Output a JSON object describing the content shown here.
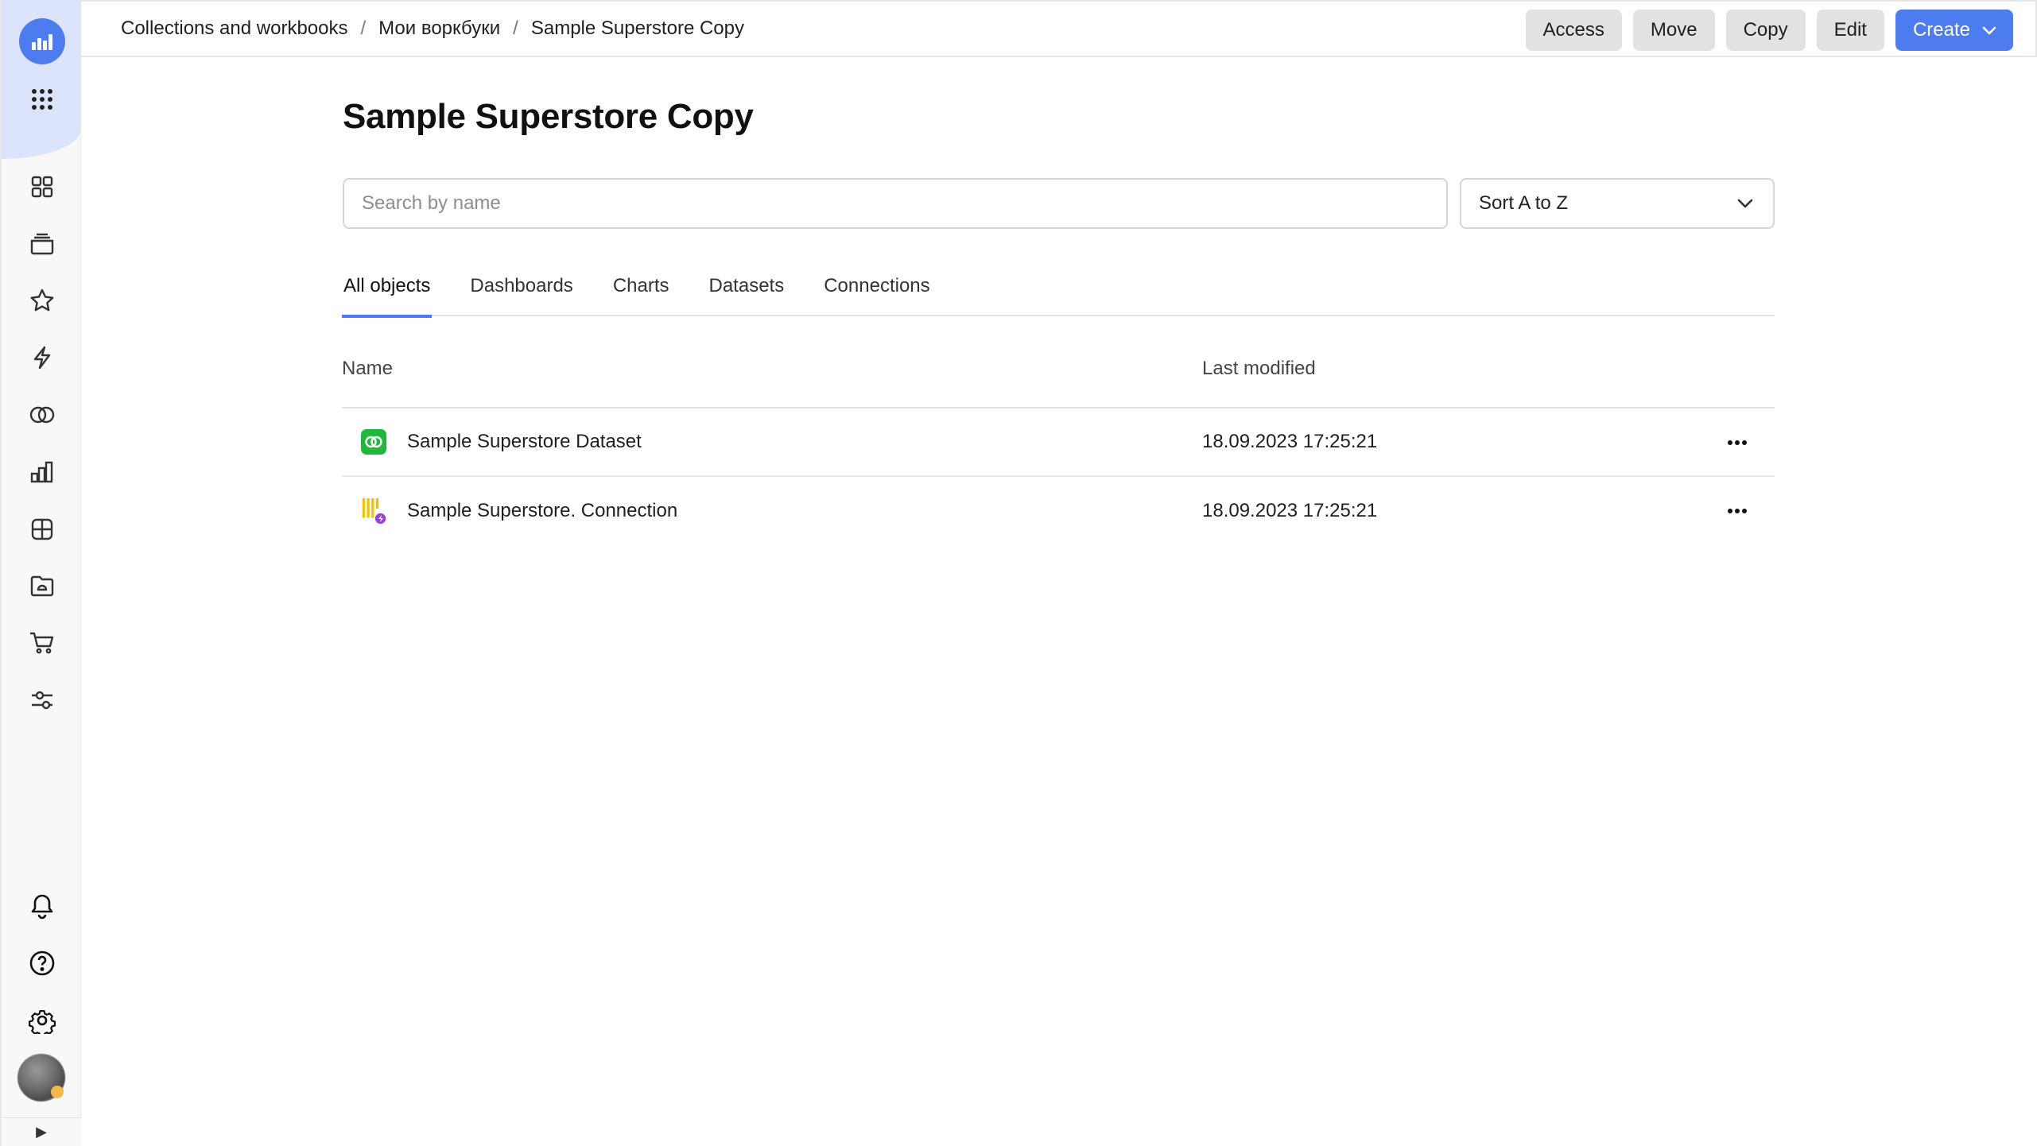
{
  "breadcrumb": {
    "items": [
      "Collections and workbooks",
      "Мои воркбуки",
      "Sample Superstore Copy"
    ],
    "separator": "/"
  },
  "actions": {
    "access": "Access",
    "move": "Move",
    "copy": "Copy",
    "edit": "Edit",
    "create": "Create"
  },
  "page": {
    "title": "Sample Superstore Copy"
  },
  "search": {
    "placeholder": "Search by name",
    "value": ""
  },
  "sort": {
    "selected": "Sort A to Z"
  },
  "tabs": [
    {
      "label": "All objects",
      "active": true
    },
    {
      "label": "Dashboards",
      "active": false
    },
    {
      "label": "Charts",
      "active": false
    },
    {
      "label": "Datasets",
      "active": false
    },
    {
      "label": "Connections",
      "active": false
    }
  ],
  "table": {
    "columns": {
      "name": "Name",
      "modified": "Last modified"
    },
    "rows": [
      {
        "name": "Sample Superstore Dataset",
        "modified": "18.09.2023 17:25:21",
        "icon": "dataset-icon"
      },
      {
        "name": "Sample Superstore. Connection",
        "modified": "18.09.2023 17:25:21",
        "icon": "connection-icon"
      }
    ]
  },
  "sidebar": {
    "icons": [
      "logo-icon",
      "services-grid-icon",
      "collections-icon",
      "workbooks-icon",
      "favorites-icon",
      "connections-icon",
      "datasets-icon",
      "charts-icon",
      "dashboards-icon",
      "reports-icon",
      "marketplace-icon",
      "settings-sliders-icon",
      "notifications-icon",
      "help-icon",
      "settings-icon",
      "avatar"
    ]
  },
  "colors": {
    "accent": "#4d7cf0",
    "dataset_icon": "#1fb83d",
    "connection_icon": "#f2c200",
    "connection_badge": "#9b3fd6"
  }
}
